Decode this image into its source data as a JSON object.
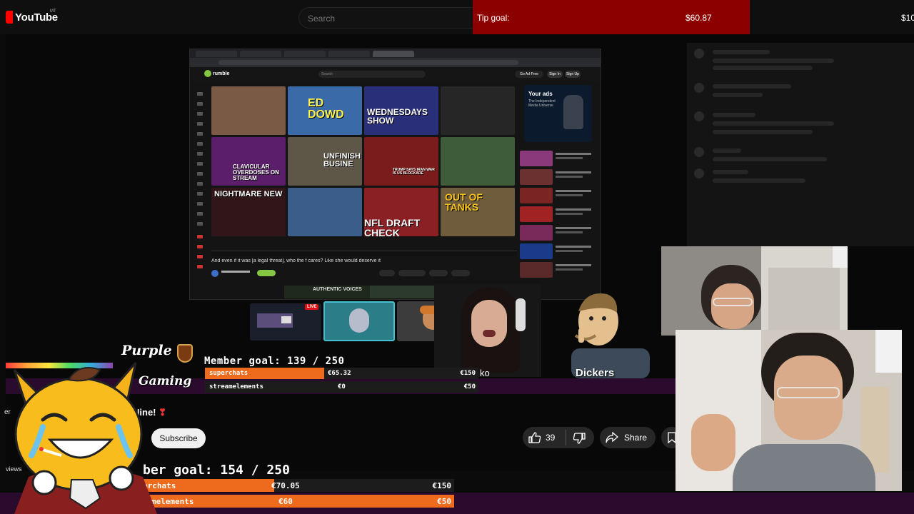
{
  "youtube": {
    "logo_text": "YouTube",
    "region": "MT",
    "search_placeholder": "Search",
    "subscribe_label": "Subscribe",
    "like_count": "39",
    "share_label": "Share",
    "channel_fragment": "er",
    "views_fragment": "views",
    "p_fragment": "P",
    "name_fragment": "Nine!",
    "name_fragment_mark": "❣"
  },
  "tip_goal": {
    "label": "Tip goal:",
    "amount": "$60.87",
    "amount_cut": "$10"
  },
  "rumble": {
    "logo": "rumble",
    "search_placeholder": "Search",
    "go_ad_free": "Go Ad-Free",
    "sign_in": "Sign In",
    "sign_up": "Sign Up",
    "caption": "And even if it was [a legal threat], who the f cares? Like she would deserve it",
    "ad_title": "Your ads",
    "ad_sub": "The Independent Media Universe",
    "banner": "AUTHENTIC VOICES",
    "tiles": [
      {
        "text": "",
        "bg": "#7a5a44"
      },
      {
        "text": "ED DOWD",
        "bg": "#3b6aa8"
      },
      {
        "text": "WEDNESDAYS SHOW",
        "bg": "#2a2f7a"
      },
      {
        "text": "",
        "bg": "#262626"
      },
      {
        "text": "CLAVICULAR OVERDOSES ON STREAM",
        "bg": "#5a1e6a"
      },
      {
        "text": "UNFINISH BUSINE",
        "bg": "#5e5647"
      },
      {
        "text": "TRUMP SAYS IRAN WAR IS US BLOCKADE",
        "bg": "#7b1c1c"
      },
      {
        "text": "",
        "bg": "#3f5c3a"
      },
      {
        "text": "NIGHTMARE NEW",
        "bg": "#301618"
      },
      {
        "text": "",
        "bg": "#3a5d89"
      },
      {
        "text": "NFL DRAFT CHECK",
        "bg": "#8a1f24"
      },
      {
        "text": "OUT OF TANKS",
        "bg": "#6f5c3c"
      }
    ]
  },
  "overlay": {
    "dickers": "Dickers",
    "ko": "ko",
    "live_badge": "LIVE",
    "purple_line1": "Purple",
    "purple_line2": "Gaming"
  },
  "member_goal_1": {
    "title": "Member goal: 139 / 250",
    "rows": [
      {
        "label": "superchats",
        "current": "€65.32",
        "target": "€150",
        "progress": 0.435
      },
      {
        "label": "streamelements",
        "current": "€0",
        "target": "€50",
        "progress": 0
      }
    ]
  },
  "member_goal_2": {
    "title": "ber goal: 154 / 250",
    "rows": [
      {
        "label": "erchats",
        "current": "€70.05",
        "target": "€150",
        "progress": 0.47
      },
      {
        "label": "reamelements",
        "current": "€60",
        "target": "€50",
        "progress": 1.0
      }
    ]
  },
  "colors": {
    "youtube_red": "#ff0000",
    "tip_goal_bg": "#8c0000",
    "goal_orange": "#ee6a1c",
    "purple_band": "#2a0a2d",
    "rumble_green": "#85c742"
  }
}
